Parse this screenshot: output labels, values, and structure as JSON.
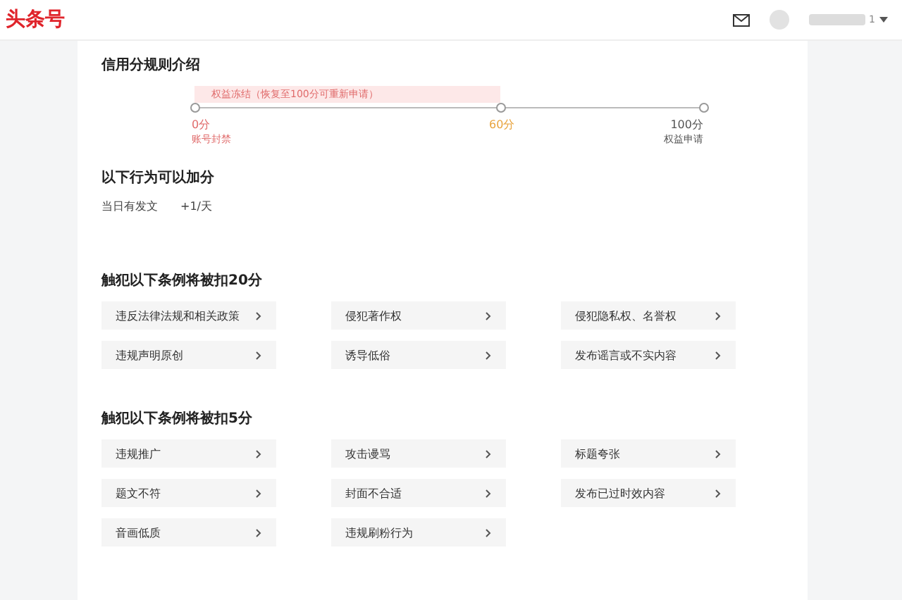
{
  "header": {
    "logo": "头条号",
    "user_suffix": "1"
  },
  "rules": {
    "title": "信用分规则介绍",
    "band": "权益冻结（恢复至100分可重新申请）",
    "points": [
      {
        "score": "0分",
        "note": "账号封禁",
        "color": "#e06b6b"
      },
      {
        "score": "60分",
        "color": "#e8a33c"
      },
      {
        "score": "100分",
        "note": "权益申请",
        "color": "#555555"
      }
    ]
  },
  "bonus": {
    "title": "以下行为可以加分",
    "items": [
      {
        "label": "当日有发文",
        "value": "+1/天"
      }
    ]
  },
  "sections": [
    {
      "title": "触犯以下条例将被扣20分",
      "items": [
        "违反法律法规和相关政策",
        "侵犯著作权",
        "侵犯隐私权、名誉权",
        "违规声明原创",
        "诱导低俗",
        "发布谣言或不实内容"
      ]
    },
    {
      "title": "触犯以下条例将被扣5分",
      "items": [
        "违规推广",
        "攻击谩骂",
        "标题夸张",
        "题文不符",
        "封面不合适",
        "发布已过时效内容",
        "音画低质",
        "违规刷粉行为"
      ]
    }
  ]
}
